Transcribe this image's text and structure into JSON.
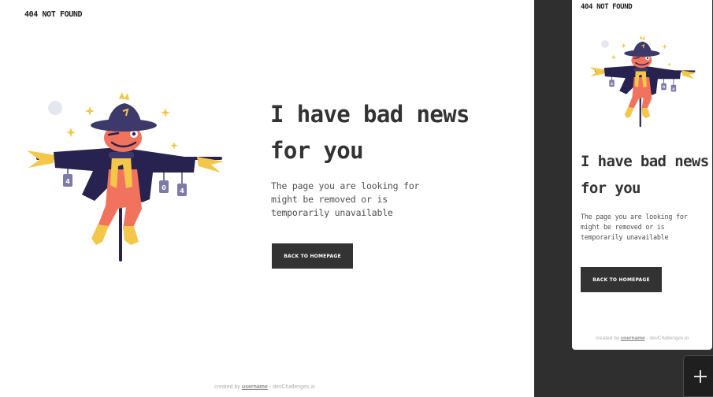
{
  "brand": "404 NOT FOUND",
  "heading": "I have bad news for you",
  "description": "The page you are looking for might be removed or is temporarily unavailable",
  "button_label": "BACK TO HOMEPAGE",
  "footer": {
    "prefix": "created by",
    "username": "username",
    "suffix": "- devChallenges.io"
  },
  "illustration": {
    "can_labels": [
      "4",
      "0",
      "4"
    ]
  },
  "colors": {
    "ink": "#333333",
    "muted_text": "#4f4f4f",
    "footer_text": "#b0b0b0",
    "gutter": "#2f2f2f",
    "hat": "#3d3a6b",
    "coat": "#27224f",
    "face": "#f1735d",
    "straw": "#f4c74b",
    "can": "#7c7aa8"
  },
  "icons": [
    "scarecrow-illustration",
    "plus-icon"
  ]
}
